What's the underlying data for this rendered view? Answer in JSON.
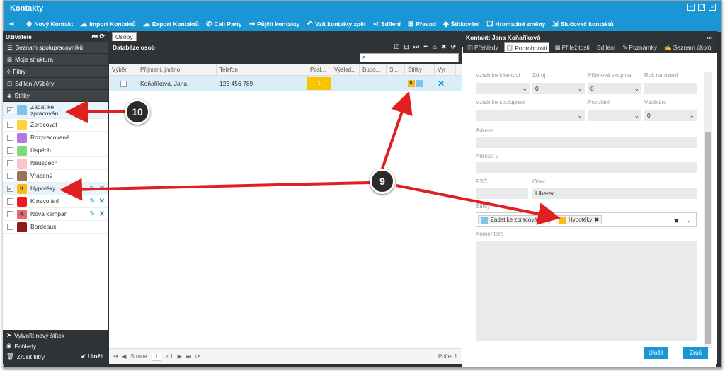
{
  "app_title": "Kontakty",
  "toolbar": [
    {
      "icon": "plus-circle-icon",
      "glyph": "⊕",
      "label": "Nový Kontakt"
    },
    {
      "icon": "cloud-upload-icon",
      "glyph": "☁",
      "label": "Import Kontaktů"
    },
    {
      "icon": "cloud-download-icon",
      "glyph": "☁",
      "label": "Export Kontaktů"
    },
    {
      "icon": "phone-icon",
      "glyph": "✆",
      "label": "Call Party"
    },
    {
      "icon": "sign-out-icon",
      "glyph": "⇥",
      "label": "Půjčit kontakty"
    },
    {
      "icon": "reply-icon",
      "glyph": "↶",
      "label": "Vzít kontakty zpět"
    },
    {
      "icon": "share-icon",
      "glyph": "⋖",
      "label": "Sdílení"
    },
    {
      "icon": "transfer-icon",
      "glyph": "⊞",
      "label": "Převod"
    },
    {
      "icon": "tags-icon",
      "glyph": "◈",
      "label": "Štítkování"
    },
    {
      "icon": "copy-icon",
      "glyph": "❐",
      "label": "Hromadné změny"
    },
    {
      "icon": "merge-icon",
      "glyph": "⇲",
      "label": "Slučovač kontaktů"
    }
  ],
  "left": {
    "header": "Uživatelé",
    "nav": [
      {
        "icon": "list-icon",
        "glyph": "☰",
        "label": "Seznam spolupracovníků"
      },
      {
        "icon": "sitemap-icon",
        "glyph": "⊠",
        "label": "Moje struktura"
      },
      {
        "icon": "filter-icon",
        "glyph": "◊",
        "label": "Filtry"
      },
      {
        "icon": "share-icon",
        "glyph": "⊡",
        "label": "Sdílení/Výběry"
      },
      {
        "icon": "tags-icon",
        "glyph": "◈",
        "label": "Štítky"
      }
    ],
    "tags": [
      {
        "label": "Zadat ke zpracování",
        "color": "#7ec3ea",
        "checked": true,
        "letter": ""
      },
      {
        "label": "Zpracovat",
        "color": "#ffd23f",
        "checked": false,
        "letter": ""
      },
      {
        "label": "Rozpracované",
        "color": "#b07ae0",
        "checked": false,
        "letter": ""
      },
      {
        "label": "Úspěch",
        "color": "#7ddb79",
        "checked": false,
        "letter": ""
      },
      {
        "label": "Neúspěch",
        "color": "#ffc3cf",
        "checked": false,
        "letter": ""
      },
      {
        "label": "Vrácený",
        "color": "#9a7456",
        "checked": false,
        "letter": ""
      },
      {
        "label": "Hypotéky",
        "color": "#f6bd16",
        "checked": true,
        "letter": "K"
      },
      {
        "label": "K navolání",
        "color": "#ee1c1c",
        "checked": false,
        "letter": ""
      },
      {
        "label": "Nová kampaň",
        "color": "#e46a73",
        "checked": false,
        "letter": "K"
      },
      {
        "label": "Bordeaux",
        "color": "#8b1a1a",
        "checked": false,
        "letter": ""
      }
    ],
    "footer": {
      "create_tag": "Vytvořit nový štítek",
      "views": "Pohledy",
      "cancel_filters": "Zrušit filtry",
      "save": "Uložit"
    }
  },
  "middle": {
    "tab": "Osoby",
    "title": "Databáze osob",
    "search_value": "",
    "columns": [
      "Výběr",
      "Příjmení, jméno",
      "Telefon",
      "Posl...",
      "Výsled...",
      "Budo...",
      "S...",
      "Štítky",
      "Vyr"
    ],
    "rows": [
      {
        "name": "Koňaříková, Jana",
        "phone": "123 456 789",
        "priority": "1",
        "tag_letter": "K"
      }
    ],
    "pager": {
      "label": "Strana",
      "page": "1",
      "of": "z 1",
      "count": "Počet 1"
    }
  },
  "right": {
    "title": "Kontakt: Jana Koňaříková",
    "tabs": [
      "Přehledy",
      "Podrobnosti",
      "Příležitosti",
      "Sdílení",
      "Poznámky",
      "Seznam úkolů"
    ],
    "active_tab": "Podrobnosti",
    "fields": {
      "vztah_ke_klientovi": {
        "label": "Vztah ke klientovi",
        "value": ""
      },
      "zdroj": {
        "label": "Zdroj",
        "value": "0"
      },
      "prijmova_skupina": {
        "label": "Příjmová skupina",
        "value": "0"
      },
      "rok_narozeni": {
        "label": "Rok narození",
        "value": ""
      },
      "vztah_ke_spolupraci": {
        "label": "Vztah ke spolupráci",
        "value": ""
      },
      "povolani": {
        "label": "Povolání",
        "value": ""
      },
      "vzdelani": {
        "label": "Vzdělání",
        "value": "0"
      },
      "adresa": {
        "label": "Adresa",
        "value": ""
      },
      "adresa2": {
        "label": "Adresa 2",
        "value": ""
      },
      "psc": {
        "label": "PSČ",
        "value": ""
      },
      "obec": {
        "label": "Obec",
        "value": "Liberec"
      },
      "stitky": {
        "label": "Štítky",
        "values": [
          "Zadat ke zpracování",
          "Hypotéky"
        ]
      },
      "komentare": {
        "label": "Komentáře",
        "value": ""
      }
    },
    "save_button": "Uložit",
    "cancel_button": "Zruš"
  },
  "annotations": {
    "badge_10": "10",
    "badge_9": "9",
    "arrow_color": "#e02020"
  }
}
